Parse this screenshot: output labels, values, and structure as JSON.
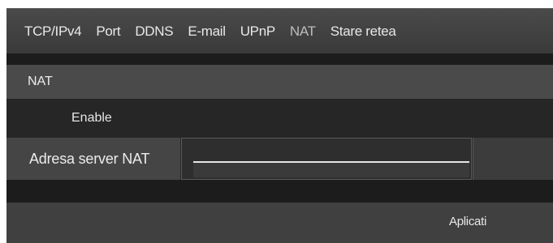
{
  "tabs": [
    {
      "label": "TCP/IPv4"
    },
    {
      "label": "Port"
    },
    {
      "label": "DDNS"
    },
    {
      "label": "E-mail"
    },
    {
      "label": "UPnP"
    },
    {
      "label": "NAT"
    },
    {
      "label": "Stare retea"
    }
  ],
  "active_tab": "NAT",
  "section": {
    "title": "NAT"
  },
  "enable": {
    "label": "Enable"
  },
  "server": {
    "label": "Adresa server NAT",
    "value": ""
  },
  "footer": {
    "apply_label": "Aplicati"
  },
  "colors": {
    "background": "#262626",
    "header": "#4a4a4a",
    "text": "#e8e8e8"
  }
}
